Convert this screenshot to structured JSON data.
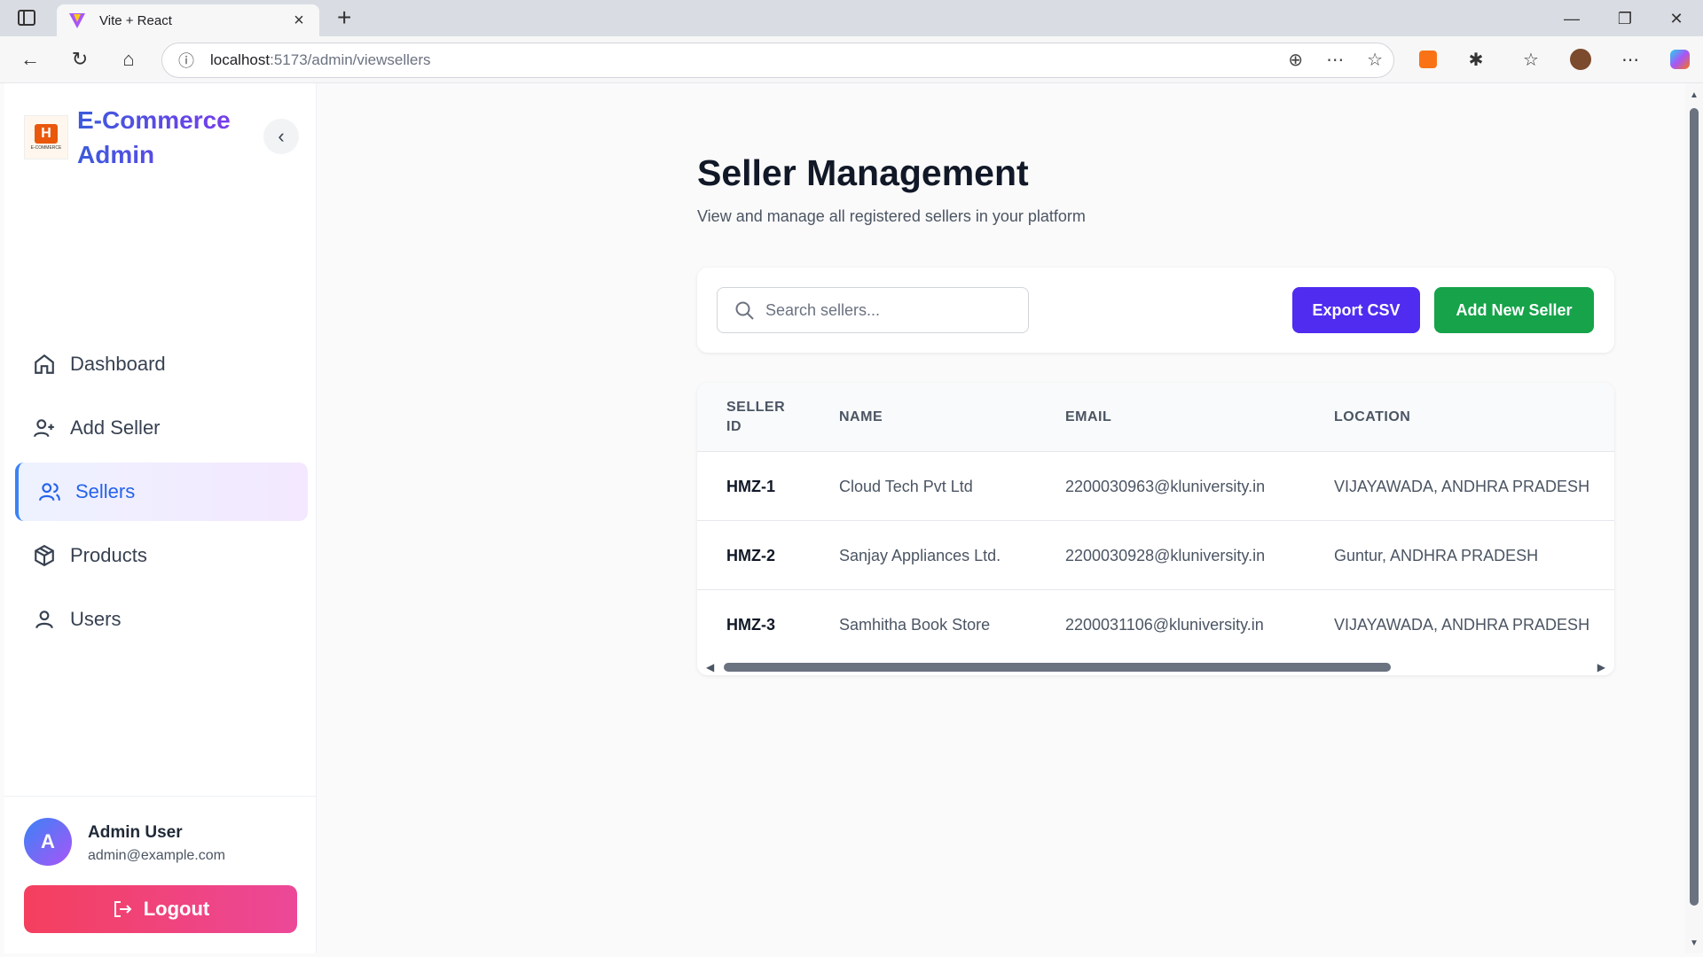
{
  "browser": {
    "tab_title": "Vite + React",
    "url_host": "localhost",
    "url_path": ":5173/admin/viewsellers"
  },
  "sidebar": {
    "brand_name": "E-Commerce Admin",
    "logo_letter": "H",
    "logo_sub": "E-COMMERCE",
    "items": [
      {
        "label": "Dashboard",
        "icon": "home-icon"
      },
      {
        "label": "Add Seller",
        "icon": "user-plus-icon"
      },
      {
        "label": "Sellers",
        "icon": "users-icon",
        "active": true
      },
      {
        "label": "Products",
        "icon": "box-icon"
      },
      {
        "label": "Users",
        "icon": "user-icon"
      }
    ],
    "user": {
      "initial": "A",
      "name": "Admin User",
      "email": "admin@example.com"
    },
    "logout_label": "Logout"
  },
  "main": {
    "title": "Seller Management",
    "subtitle": "View and manage all registered sellers in your platform",
    "search_placeholder": "Search sellers...",
    "export_label": "Export CSV",
    "add_label": "Add New Seller",
    "table": {
      "headers": [
        "SELLER ID",
        "NAME",
        "EMAIL",
        "LOCATION"
      ],
      "rows": [
        [
          "HMZ-1",
          "Cloud Tech Pvt Ltd",
          "2200030963@kluniversity.in",
          "VIJAYAWADA, ANDHRA PRADESH"
        ],
        [
          "HMZ-2",
          "Sanjay Appliances Ltd.",
          "2200030928@kluniversity.in",
          "Guntur, ANDHRA PRADESH"
        ],
        [
          "HMZ-3",
          "Samhitha Book Store",
          "2200031106@kluniversity.in",
          "VIJAYAWADA, ANDHRA PRADESH"
        ]
      ]
    }
  },
  "colors": {
    "accent": "#4f2cf0",
    "success": "#16a34a",
    "danger": "#f43f5e",
    "active_nav": "#2563eb"
  }
}
